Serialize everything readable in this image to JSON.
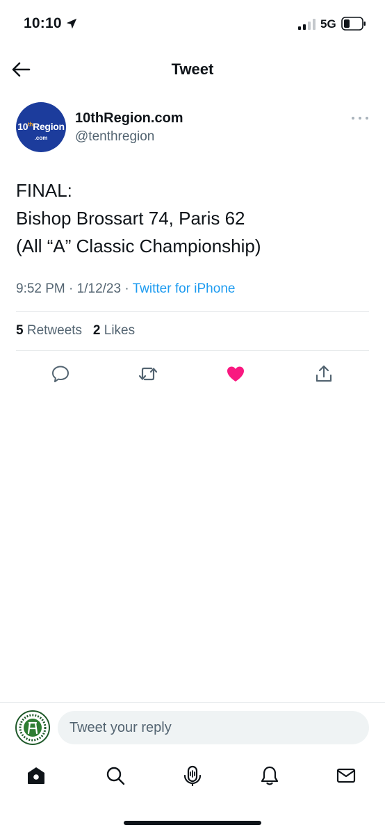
{
  "status_bar": {
    "time": "10:10",
    "network": "5G"
  },
  "header": {
    "title": "Tweet"
  },
  "author": {
    "avatar_text": "10thRegion",
    "avatar_superscript": "th",
    "avatar_prefix": "10",
    "avatar_suffix": "Region",
    "avatar_sub": ".com",
    "name": "10thRegion.com",
    "handle": "@tenthregion"
  },
  "tweet": {
    "lines": [
      "FINAL:",
      "Bishop Brossart 74, Paris 62",
      "(All “A” Classic Championship)"
    ],
    "time": "9:52 PM",
    "date": "1/12/23",
    "source": "Twitter for iPhone",
    "retweets_count": "5",
    "retweets_label": "Retweets",
    "likes_count": "2",
    "likes_label": "Likes"
  },
  "reply": {
    "placeholder": "Tweet your reply"
  },
  "colors": {
    "accent": "#1d9bf0",
    "like": "#f91880",
    "avatar_bg": "#1c3c9c"
  },
  "icons": {
    "back": "arrow-left-icon",
    "reply": "chat-bubble-icon",
    "retweet": "retweet-icon",
    "like": "heart-filled-icon",
    "share": "share-icon",
    "home": "home-icon",
    "search": "search-icon",
    "spaces": "microphone-icon",
    "notifications": "bell-icon",
    "messages": "mail-icon"
  }
}
